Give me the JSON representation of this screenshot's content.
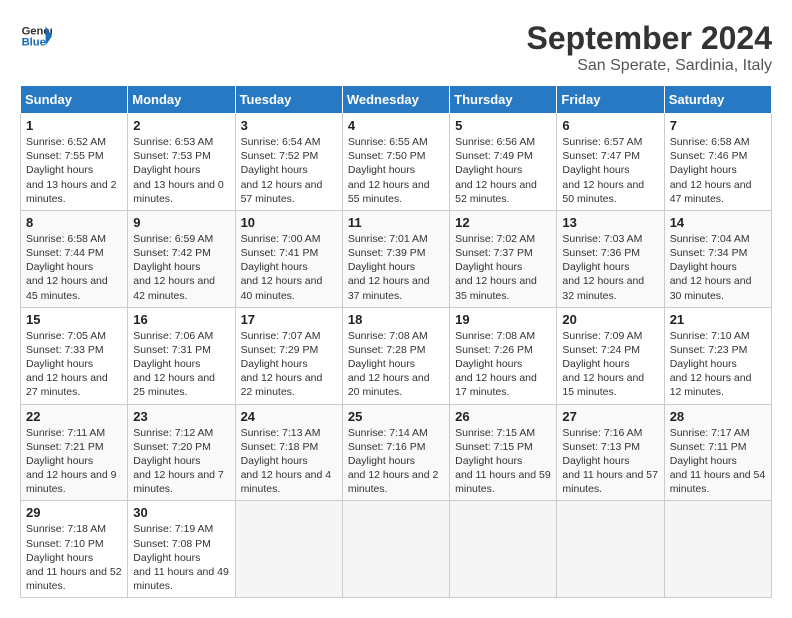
{
  "header": {
    "logo_line1": "General",
    "logo_line2": "Blue",
    "month_title": "September 2024",
    "location": "San Sperate, Sardinia, Italy"
  },
  "columns": [
    "Sunday",
    "Monday",
    "Tuesday",
    "Wednesday",
    "Thursday",
    "Friday",
    "Saturday"
  ],
  "weeks": [
    [
      {
        "day": "1",
        "sunrise": "6:52 AM",
        "sunset": "7:55 PM",
        "daylight": "13 hours and 2 minutes."
      },
      {
        "day": "2",
        "sunrise": "6:53 AM",
        "sunset": "7:53 PM",
        "daylight": "13 hours and 0 minutes."
      },
      {
        "day": "3",
        "sunrise": "6:54 AM",
        "sunset": "7:52 PM",
        "daylight": "12 hours and 57 minutes."
      },
      {
        "day": "4",
        "sunrise": "6:55 AM",
        "sunset": "7:50 PM",
        "daylight": "12 hours and 55 minutes."
      },
      {
        "day": "5",
        "sunrise": "6:56 AM",
        "sunset": "7:49 PM",
        "daylight": "12 hours and 52 minutes."
      },
      {
        "day": "6",
        "sunrise": "6:57 AM",
        "sunset": "7:47 PM",
        "daylight": "12 hours and 50 minutes."
      },
      {
        "day": "7",
        "sunrise": "6:58 AM",
        "sunset": "7:46 PM",
        "daylight": "12 hours and 47 minutes."
      }
    ],
    [
      {
        "day": "8",
        "sunrise": "6:58 AM",
        "sunset": "7:44 PM",
        "daylight": "12 hours and 45 minutes."
      },
      {
        "day": "9",
        "sunrise": "6:59 AM",
        "sunset": "7:42 PM",
        "daylight": "12 hours and 42 minutes."
      },
      {
        "day": "10",
        "sunrise": "7:00 AM",
        "sunset": "7:41 PM",
        "daylight": "12 hours and 40 minutes."
      },
      {
        "day": "11",
        "sunrise": "7:01 AM",
        "sunset": "7:39 PM",
        "daylight": "12 hours and 37 minutes."
      },
      {
        "day": "12",
        "sunrise": "7:02 AM",
        "sunset": "7:37 PM",
        "daylight": "12 hours and 35 minutes."
      },
      {
        "day": "13",
        "sunrise": "7:03 AM",
        "sunset": "7:36 PM",
        "daylight": "12 hours and 32 minutes."
      },
      {
        "day": "14",
        "sunrise": "7:04 AM",
        "sunset": "7:34 PM",
        "daylight": "12 hours and 30 minutes."
      }
    ],
    [
      {
        "day": "15",
        "sunrise": "7:05 AM",
        "sunset": "7:33 PM",
        "daylight": "12 hours and 27 minutes."
      },
      {
        "day": "16",
        "sunrise": "7:06 AM",
        "sunset": "7:31 PM",
        "daylight": "12 hours and 25 minutes."
      },
      {
        "day": "17",
        "sunrise": "7:07 AM",
        "sunset": "7:29 PM",
        "daylight": "12 hours and 22 minutes."
      },
      {
        "day": "18",
        "sunrise": "7:08 AM",
        "sunset": "7:28 PM",
        "daylight": "12 hours and 20 minutes."
      },
      {
        "day": "19",
        "sunrise": "7:08 AM",
        "sunset": "7:26 PM",
        "daylight": "12 hours and 17 minutes."
      },
      {
        "day": "20",
        "sunrise": "7:09 AM",
        "sunset": "7:24 PM",
        "daylight": "12 hours and 15 minutes."
      },
      {
        "day": "21",
        "sunrise": "7:10 AM",
        "sunset": "7:23 PM",
        "daylight": "12 hours and 12 minutes."
      }
    ],
    [
      {
        "day": "22",
        "sunrise": "7:11 AM",
        "sunset": "7:21 PM",
        "daylight": "12 hours and 9 minutes."
      },
      {
        "day": "23",
        "sunrise": "7:12 AM",
        "sunset": "7:20 PM",
        "daylight": "12 hours and 7 minutes."
      },
      {
        "day": "24",
        "sunrise": "7:13 AM",
        "sunset": "7:18 PM",
        "daylight": "12 hours and 4 minutes."
      },
      {
        "day": "25",
        "sunrise": "7:14 AM",
        "sunset": "7:16 PM",
        "daylight": "12 hours and 2 minutes."
      },
      {
        "day": "26",
        "sunrise": "7:15 AM",
        "sunset": "7:15 PM",
        "daylight": "11 hours and 59 minutes."
      },
      {
        "day": "27",
        "sunrise": "7:16 AM",
        "sunset": "7:13 PM",
        "daylight": "11 hours and 57 minutes."
      },
      {
        "day": "28",
        "sunrise": "7:17 AM",
        "sunset": "7:11 PM",
        "daylight": "11 hours and 54 minutes."
      }
    ],
    [
      {
        "day": "29",
        "sunrise": "7:18 AM",
        "sunset": "7:10 PM",
        "daylight": "11 hours and 52 minutes."
      },
      {
        "day": "30",
        "sunrise": "7:19 AM",
        "sunset": "7:08 PM",
        "daylight": "11 hours and 49 minutes."
      },
      null,
      null,
      null,
      null,
      null
    ]
  ]
}
